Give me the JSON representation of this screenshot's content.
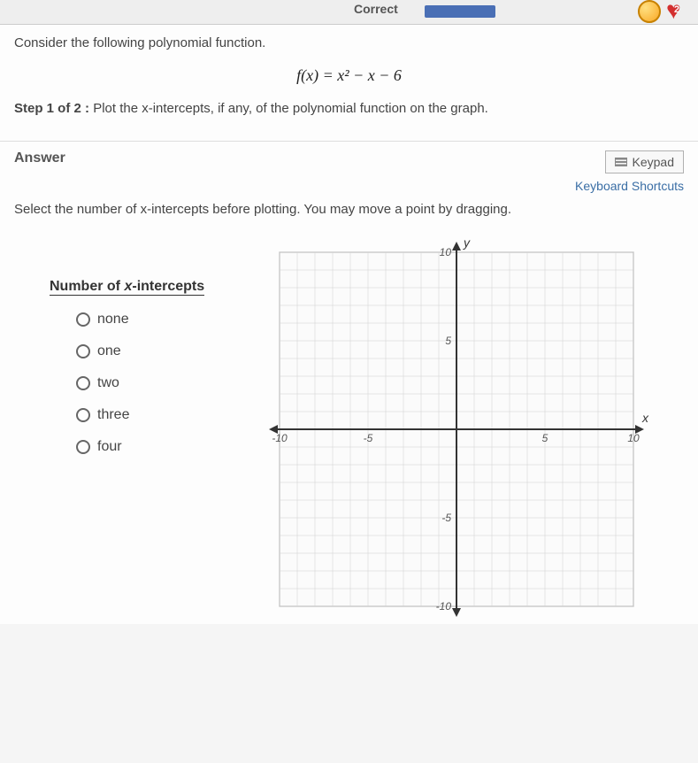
{
  "topbar": {
    "correct_label": "Correct",
    "heart_count": "2"
  },
  "question": {
    "prompt": "Consider the following polynomial function.",
    "equation": "f(x) = x² − x − 6",
    "step_bold": "Step 1 of 2 :",
    "step_text": "Plot the x-intercepts, if any, of the polynomial function on the graph."
  },
  "answer_section": {
    "label": "Answer",
    "keypad_label": "Keypad",
    "shortcuts_label": "Keyboard Shortcuts",
    "instruction": "Select the number of x-intercepts before plotting. You may move a point by dragging."
  },
  "options": {
    "header": "Number of x-intercepts",
    "items": [
      "none",
      "one",
      "two",
      "three",
      "four"
    ]
  },
  "chart_data": {
    "type": "scatter",
    "title": "",
    "xlabel": "x",
    "ylabel": "y",
    "xlim": [
      -10,
      10
    ],
    "ylim": [
      -10,
      10
    ],
    "xticks": [
      -10,
      -5,
      5,
      10
    ],
    "yticks": [
      -10,
      -5,
      5,
      10
    ],
    "grid": true,
    "series": [
      {
        "name": "plotted-points",
        "points": []
      }
    ]
  }
}
